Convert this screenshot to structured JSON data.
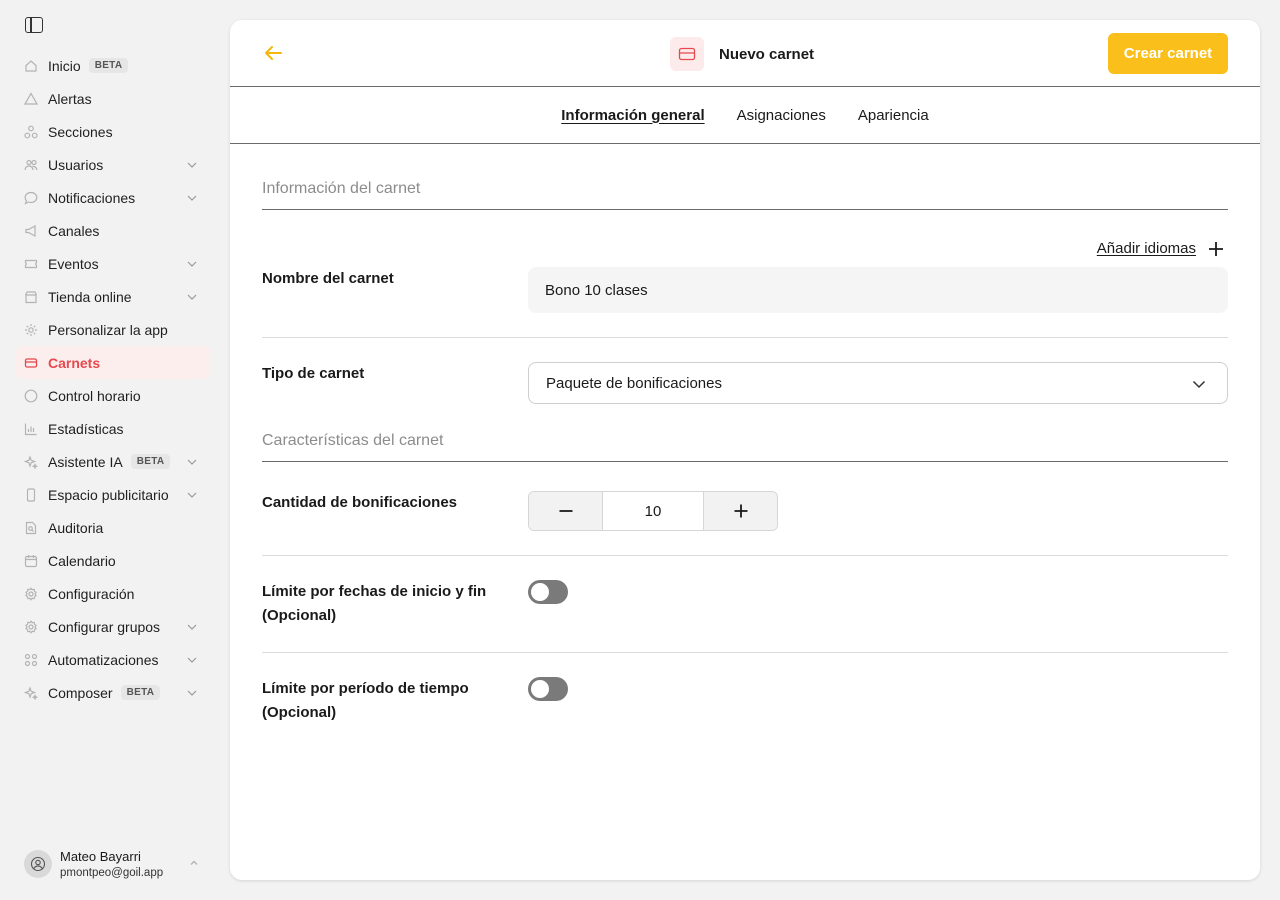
{
  "sidebar": {
    "items": [
      {
        "label": "Inicio",
        "icon": "home-icon",
        "badge": "BETA"
      },
      {
        "label": "Alertas",
        "icon": "alert-icon"
      },
      {
        "label": "Secciones",
        "icon": "sections-icon"
      },
      {
        "label": "Usuarios",
        "icon": "users-icon"
      },
      {
        "label": "Notificaciones",
        "icon": "chat-icon"
      },
      {
        "label": "Canales",
        "icon": "megaphone-icon"
      },
      {
        "label": "Eventos",
        "icon": "ticket-icon"
      },
      {
        "label": "Tienda online",
        "icon": "store-icon"
      },
      {
        "label": "Personalizar la app",
        "icon": "customize-icon"
      },
      {
        "label": "Carnets",
        "icon": "card-icon"
      },
      {
        "label": "Control horario",
        "icon": "clock-icon"
      },
      {
        "label": "Estadísticas",
        "icon": "stats-icon"
      },
      {
        "label": "Asistente IA",
        "icon": "sparkle-icon",
        "badge": "BETA"
      },
      {
        "label": "Espacio publicitario",
        "icon": "phone-icon"
      },
      {
        "label": "Auditoria",
        "icon": "audit-icon"
      },
      {
        "label": "Calendario",
        "icon": "calendar-icon"
      },
      {
        "label": "Configuración",
        "icon": "gear-icon"
      },
      {
        "label": "Configurar grupos",
        "icon": "group-gear-icon"
      },
      {
        "label": "Automatizaciones",
        "icon": "automation-icon"
      },
      {
        "label": "Composer",
        "icon": "sparkle-icon",
        "badge": "BETA"
      }
    ],
    "user": {
      "name": "Mateo Bayarri",
      "email": "pmontpeo@goil.app"
    }
  },
  "header": {
    "title": "Nuevo carnet",
    "create_label": "Crear carnet"
  },
  "tabs": [
    "Información general",
    "Asignaciones",
    "Apariencia"
  ],
  "form": {
    "section1_title": "Información del carnet",
    "add_languages": "Añadir idiomas",
    "name_label": "Nombre del carnet",
    "name_value": "Bono 10 clases",
    "type_label": "Tipo de carnet",
    "type_value": "Paquete de bonificaciones",
    "section2_title": "Características del carnet",
    "quantity_label": "Cantidad de bonificaciones",
    "quantity_value": "10",
    "date_limit_label_1": "Límite por fechas de inicio y fin",
    "date_limit_label_2": "(Opcional)",
    "period_limit_label_1": "Límite por período de tiempo",
    "period_limit_label_2": "(Opcional)"
  },
  "colors": {
    "accent": "#fbbf1c",
    "active": "#e5484d"
  }
}
